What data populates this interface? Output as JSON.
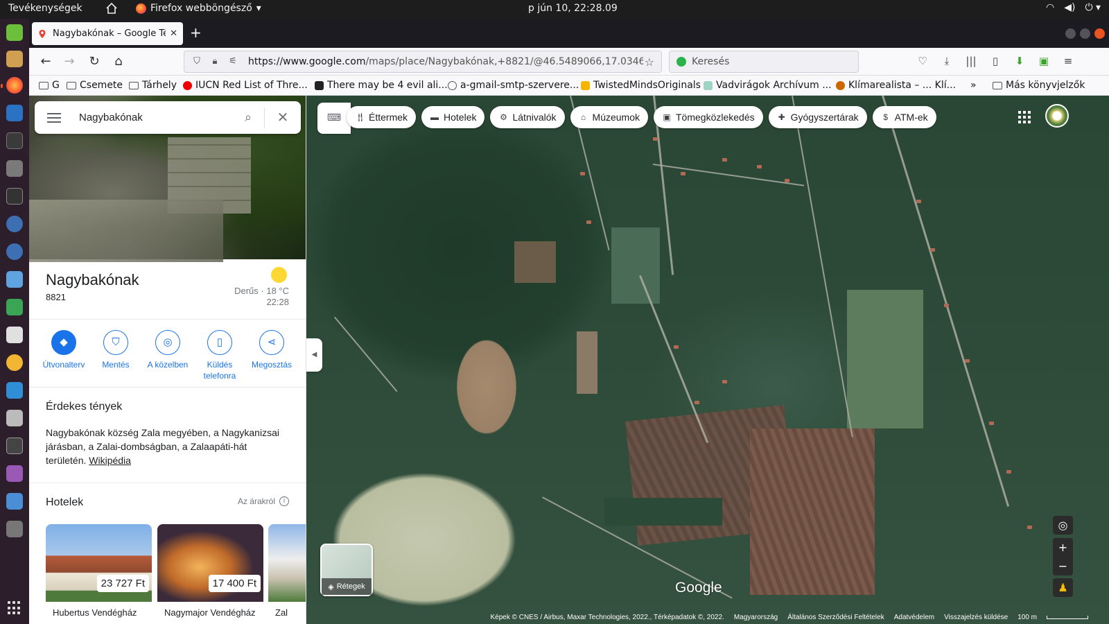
{
  "system": {
    "activities": "Tevékenységek",
    "app_name": "Firefox webböngésző",
    "clock": "p jún 10, 22:28.09",
    "tray": [
      "wifi-icon",
      "volume-icon",
      "power-icon"
    ]
  },
  "browser": {
    "tab_title": "Nagybakónak – Google Térkép",
    "url_domain": "https://www.google.com",
    "url_rest": "/maps/place/Nagybakónak,+8821/@46.5489066,17.0346",
    "search_placeholder": "Keresés",
    "bookmarks": [
      {
        "label": "G",
        "type": "folder"
      },
      {
        "label": "Csemete",
        "type": "folder"
      },
      {
        "label": "Tárhely",
        "type": "folder"
      },
      {
        "label": "IUCN Red List of Thre...",
        "type": "site",
        "color": "#e00"
      },
      {
        "label": "There may be 4 evil ali...",
        "type": "site",
        "color": "#222"
      },
      {
        "label": "a-gmail-smtp-szervere...",
        "type": "site",
        "color": "#666"
      },
      {
        "label": "TwistedMindsOriginals",
        "type": "site",
        "color": "#f5b400"
      },
      {
        "label": "Vadvirágok Archívum ...",
        "type": "site",
        "color": "#7cb"
      },
      {
        "label": "Klímarealista – ... Klí...",
        "type": "site",
        "color": "#c60"
      },
      {
        "label": "Más könyvjelzők",
        "type": "folder"
      }
    ]
  },
  "maps": {
    "search_value": "Nagybakónak",
    "place": {
      "name": "Nagybakónak",
      "postcode": "8821",
      "weather_line1": "Derűs · 18 °C",
      "weather_line2": "22:28"
    },
    "actions": [
      {
        "label": "Útvonalterv",
        "icon": "directions-icon"
      },
      {
        "label": "Mentés",
        "icon": "bookmark-icon"
      },
      {
        "label": "A közelben",
        "icon": "nearby-icon"
      },
      {
        "label": "Küldés telefonra",
        "icon": "send-to-phone-icon"
      },
      {
        "label": "Megosztás",
        "icon": "share-icon"
      }
    ],
    "facts_title": "Érdekes tények",
    "facts_text": "Nagybakónak község Zala megyében, a Nagykanizsai járásban, a Zalai-dombságban, a Zalaapáti-hát területén.",
    "facts_link": "Wikipédia",
    "hotels_title": "Hotelek",
    "prices_label": "Az árakról",
    "hotels": [
      {
        "price": "23 727 Ft",
        "name": "Hubertus Vendégház"
      },
      {
        "price": "17 400 Ft",
        "name": "Nagymajor Vendégház"
      },
      {
        "price": "",
        "name": "Zal"
      }
    ],
    "chips": [
      {
        "label": "Éttermek",
        "icon": "restaurant-icon"
      },
      {
        "label": "Hotelek",
        "icon": "hotel-icon"
      },
      {
        "label": "Látnivalók",
        "icon": "attractions-icon"
      },
      {
        "label": "Múzeumok",
        "icon": "museum-icon"
      },
      {
        "label": "Tömegközlekedés",
        "icon": "transit-icon"
      },
      {
        "label": "Gyógyszertárak",
        "icon": "pharmacy-icon"
      },
      {
        "label": "ATM-ek",
        "icon": "atm-icon"
      }
    ],
    "layers_label": "Rétegek",
    "logo": "Google",
    "footer": {
      "imagery": "Képek © CNES / Airbus, Maxar Technologies, 2022., Térképadatok ©, 2022.",
      "country": "Magyarország",
      "terms": "Általános Szerződési Feltételek",
      "privacy": "Adatvédelem",
      "feedback": "Visszajelzés küldése",
      "scale": "100 m"
    }
  }
}
